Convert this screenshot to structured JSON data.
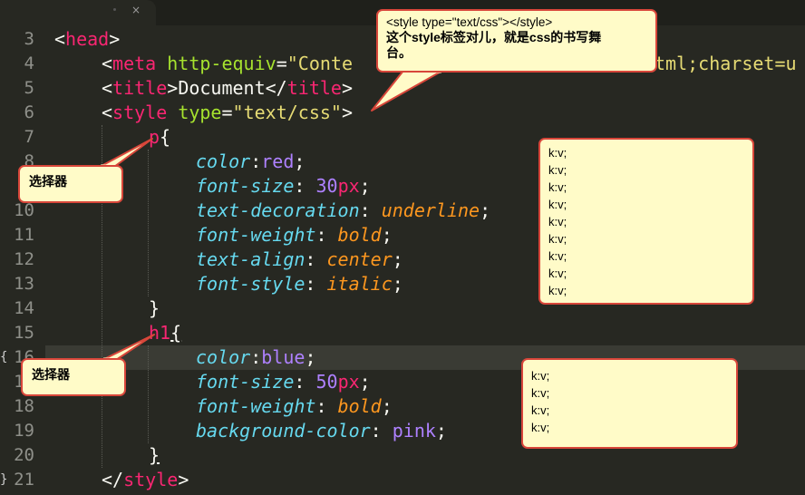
{
  "tab": {
    "close_glyph": "×"
  },
  "gutter": {
    "line_numbers": [
      "3",
      "4",
      "5",
      "6",
      "7",
      "8",
      "9",
      "10",
      "11",
      "12",
      "13",
      "14",
      "15",
      "16",
      "17",
      "18",
      "19",
      "20",
      "21"
    ],
    "fold_15": "{",
    "fold_20": "}"
  },
  "code": {
    "l3": {
      "lt": "<",
      "tag": "head",
      "gt": ">"
    },
    "l4": {
      "lt": "<",
      "tag": "meta",
      "sp": " ",
      "attr": "http-equiv",
      "eq": "=",
      "str": "\"Conte",
      "tail": "tml;charset=u"
    },
    "l5": {
      "lt": "<",
      "tag": "title",
      "gt": ">",
      "text": "Document",
      "lt2": "</",
      "tag2": "title",
      "gt2": ">"
    },
    "l6": {
      "lt": "<",
      "tag": "style",
      "sp": " ",
      "attr": "type",
      "eq": "=",
      "str": "\"text/css\"",
      "gt": ">"
    },
    "l7": {
      "sel": "p",
      "brace": "{"
    },
    "l8": {
      "prop": "color",
      "colon": ":",
      "val": "red",
      "semi": ";"
    },
    "l9": {
      "prop": "font-size",
      "colon": ": ",
      "num": "30",
      "unit": "px",
      "semi": ";"
    },
    "l10": {
      "prop": "text-decoration",
      "colon": ": ",
      "kw": "underline",
      "semi": ";"
    },
    "l11": {
      "prop": "font-weight",
      "colon": ": ",
      "kw": "bold",
      "semi": ";"
    },
    "l12": {
      "prop": "text-align",
      "colon": ": ",
      "kw": "center",
      "semi": ";"
    },
    "l13": {
      "prop": "font-style",
      "colon": ": ",
      "kw": "italic",
      "semi": ";"
    },
    "l14": {
      "brace": "}"
    },
    "l15": {
      "sel": "h1",
      "brace": "{"
    },
    "l16": {
      "prop": "color",
      "colon": ":",
      "val": "blue",
      "semi": ";"
    },
    "l17": {
      "prop": "font-size",
      "colon": ": ",
      "num": "50",
      "unit": "px",
      "semi": ";"
    },
    "l18": {
      "prop": "font-weight",
      "colon": ": ",
      "kw": "bold",
      "semi": ";"
    },
    "l19": {
      "prop": "background-color",
      "colon": ": ",
      "val": "pink",
      "semi": ";"
    },
    "l20": {
      "brace": "}"
    },
    "l21": {
      "lt": "</",
      "tag": "style",
      "gt": ">"
    }
  },
  "annotations": {
    "style_note": {
      "line1": "<style type=\"text/css\"></style>",
      "line2": "这个style标签对儿，就是css的书写舞",
      "line3": "台。"
    },
    "selector_note_1": "选择器",
    "selector_note_2": "选择器",
    "kv_box_1": [
      "k:v;",
      "k:v;",
      "k:v;",
      "k:v;",
      "k:v;",
      "k:v;",
      "k:v;",
      "k:v;",
      "k:v;"
    ],
    "kv_box_2": [
      "k:v;",
      "k:v;",
      "k:v;",
      "k:v;"
    ]
  },
  "colors": {
    "background": "#272822",
    "tag": "#f92672",
    "attribute": "#a6e22e",
    "string": "#e6db74",
    "property": "#66d9ef",
    "value": "#ae81ff",
    "keyword": "#fd971f",
    "note_fill": "#fffbc8",
    "note_border": "#d8463a"
  }
}
